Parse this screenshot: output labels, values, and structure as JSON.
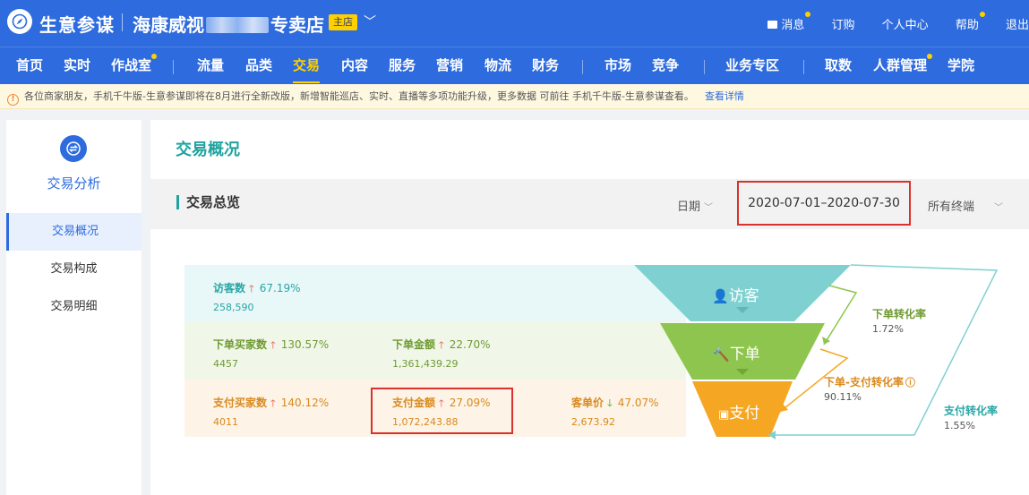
{
  "header": {
    "brand": "生意参谋",
    "store_prefix": "海康威视",
    "store_suffix": "专卖店",
    "store_badge": "主店",
    "links": [
      "消息",
      "订购",
      "个人中心",
      "帮助",
      "退出"
    ]
  },
  "nav": [
    "首页",
    "实时",
    "作战室",
    "流量",
    "品类",
    "交易",
    "内容",
    "服务",
    "营销",
    "物流",
    "财务",
    "市场",
    "竞争",
    "业务专区",
    "取数",
    "人群管理",
    "学院"
  ],
  "nav_active": "交易",
  "notice": {
    "text": "各位商家朋友，手机千牛版-生意参谋即将在8月进行全新改版，新增智能巡店、实时、直播等多项功能升级，更多数据 可前往 手机千牛版-生意参谋查看。",
    "link": "查看详情"
  },
  "sidebar": {
    "title": "交易分析",
    "items": [
      "交易概况",
      "交易构成",
      "交易明细"
    ]
  },
  "page": {
    "title": "交易概况",
    "section": "交易总览",
    "date_label": "日期",
    "date_range": "2020-07-01–2020-07-30",
    "terminal": "所有终端"
  },
  "funnel": {
    "visit": {
      "label": "访客数",
      "pct": "67.19%",
      "value": "258,590",
      "stage": "访客"
    },
    "order_buyers": {
      "label": "下单买家数",
      "pct": "130.57%",
      "value": "4457"
    },
    "order_amount": {
      "label": "下单金额",
      "pct": "22.70%",
      "value": "1,361,439.29"
    },
    "order_stage": "下单",
    "pay_buyers": {
      "label": "支付买家数",
      "pct": "140.12%",
      "value": "4011"
    },
    "pay_amount": {
      "label": "支付金额",
      "pct": "27.09%",
      "value": "1,072,243.88"
    },
    "unit_price": {
      "label": "客单价",
      "pct": "47.07%",
      "value": "2,673.92"
    },
    "pay_stage": "支付",
    "rates": {
      "order_conv": {
        "label": "下单转化率",
        "value": "1.72%"
      },
      "order_pay_conv": {
        "label": "下单-支付转化率",
        "value": "90.11%"
      },
      "pay_conv": {
        "label": "支付转化率",
        "value": "1.55%"
      }
    }
  },
  "colors": {
    "primary": "#2d6bde",
    "accent_yellow": "#ffd000",
    "teal": "#7fd1d1",
    "green": "#8ec54e",
    "orange": "#f5a623",
    "highlight": "#d9322e"
  }
}
